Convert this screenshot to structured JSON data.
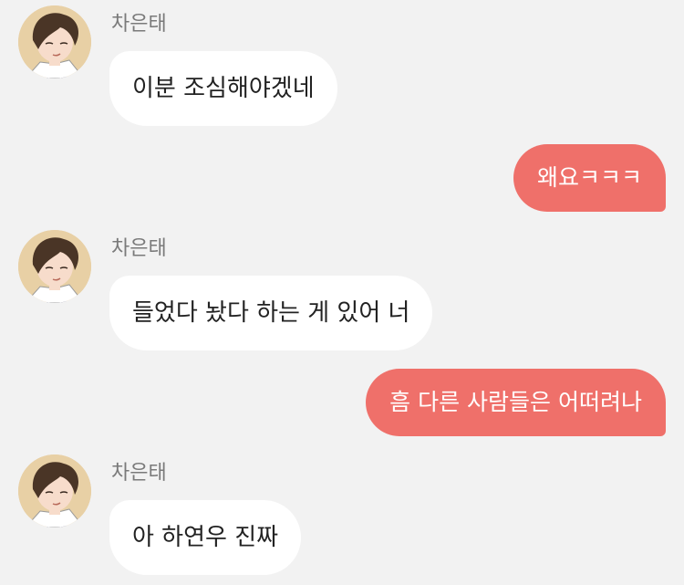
{
  "chat": {
    "messages": [
      {
        "sender": "차은태",
        "text": "이분 조심해야겠네",
        "direction": "incoming"
      },
      {
        "sender": "",
        "text": "왜요ㅋㅋㅋ",
        "direction": "outgoing"
      },
      {
        "sender": "차은태",
        "text": "들었다 놨다 하는 게 있어 너",
        "direction": "incoming"
      },
      {
        "sender": "",
        "text": "흠 다른 사람들은 어떠려나",
        "direction": "outgoing"
      },
      {
        "sender": "차은태",
        "text": "아 하연우 진짜",
        "direction": "incoming"
      }
    ]
  },
  "colors": {
    "background": "#f2f2f2",
    "incoming_bubble": "#ffffff",
    "outgoing_bubble": "#ef706a",
    "sender_name": "#7a7a7a"
  }
}
